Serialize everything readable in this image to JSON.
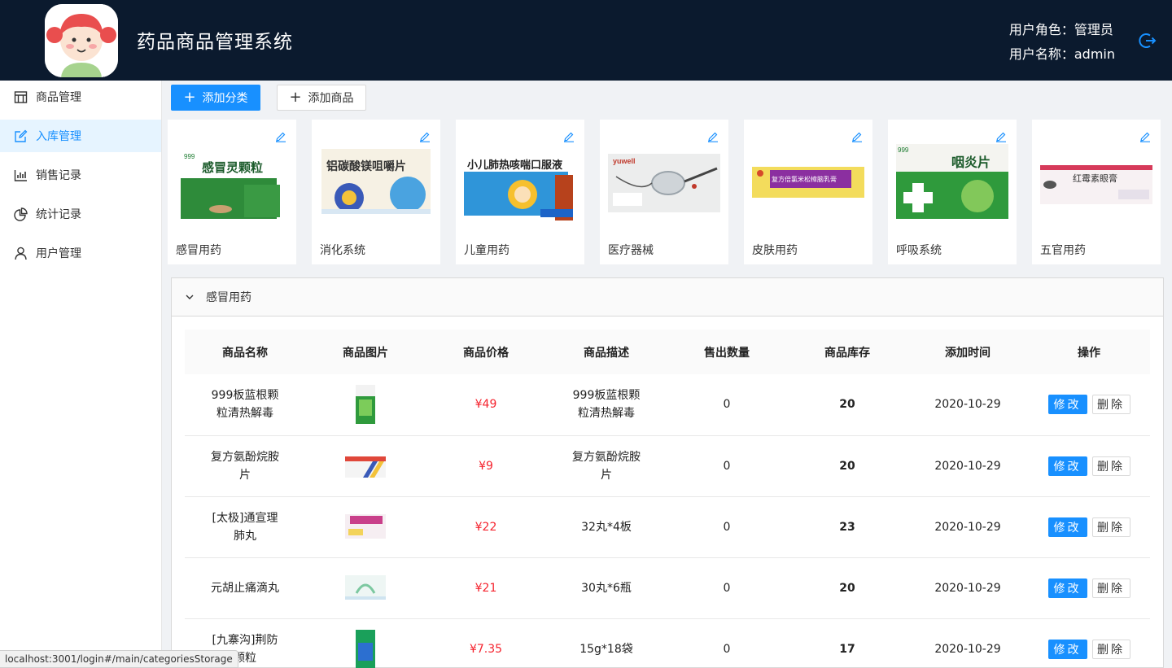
{
  "header": {
    "title": "药品商品管理系统",
    "role_line": "用户角色：管理员",
    "name_line": "用户名称：admin"
  },
  "sidebar": {
    "items": [
      {
        "label": "商品管理",
        "icon": "shop-icon",
        "active": false
      },
      {
        "label": "入库管理",
        "icon": "edit-icon",
        "active": true
      },
      {
        "label": "销售记录",
        "icon": "bar-chart-icon",
        "active": false
      },
      {
        "label": "统计记录",
        "icon": "pie-chart-icon",
        "active": false
      },
      {
        "label": "用户管理",
        "icon": "user-icon",
        "active": false
      }
    ]
  },
  "toolbar": {
    "add_category_label": "添加分类",
    "add_product_label": "添加商品"
  },
  "categories": [
    {
      "label": "感冒用药",
      "box_text": "感冒灵颗粒",
      "brand": "999"
    },
    {
      "label": "消化系统",
      "box_text": "铝碳酸镁咀嚼片",
      "brand": ""
    },
    {
      "label": "儿童用药",
      "box_text": "小儿肺热咳喘口服液",
      "brand": ""
    },
    {
      "label": "医疗器械",
      "box_text": "yuwell",
      "brand": ""
    },
    {
      "label": "皮肤用药",
      "box_text": "复方倍氯米松樟脑乳膏",
      "brand": ""
    },
    {
      "label": "呼吸系统",
      "box_text": "咽炎片",
      "brand": "999"
    },
    {
      "label": "五官用药",
      "box_text": "红霉素眼膏",
      "brand": ""
    }
  ],
  "panel": {
    "title": "感冒用药"
  },
  "table": {
    "columns": [
      "商品名称",
      "商品图片",
      "商品价格",
      "商品描述",
      "售出数量",
      "商品库存",
      "添加时间",
      "操作"
    ],
    "rows": [
      {
        "name": "999板蓝根颗粒清热解毒",
        "price": "¥49",
        "desc": "999板蓝根颗粒清热解毒",
        "sold": "0",
        "stock": "20",
        "date": "2020-10-29"
      },
      {
        "name": "复方氨酚烷胺片",
        "price": "¥9",
        "desc": "复方氨酚烷胺片",
        "sold": "0",
        "stock": "20",
        "date": "2020-10-29"
      },
      {
        "name": "[太极]通宣理肺丸",
        "price": "¥22",
        "desc": "32丸*4板",
        "sold": "0",
        "stock": "23",
        "date": "2020-10-29"
      },
      {
        "name": "元胡止痛滴丸",
        "price": "¥21",
        "desc": "30丸*6瓶",
        "sold": "0",
        "stock": "20",
        "date": "2020-10-29"
      },
      {
        "name": "[九寨沟]荆防颗粒",
        "price": "¥7.35",
        "desc": "15g*18袋",
        "sold": "0",
        "stock": "17",
        "date": "2020-10-29"
      }
    ],
    "edit_label": "修改",
    "delete_label": "删除"
  },
  "statusbar": {
    "url": "localhost:3001/login#/main/categoriesStorage"
  },
  "colors": {
    "header_bg": "#0b1a2e",
    "primary": "#1890ff",
    "price": "#f5222d"
  }
}
